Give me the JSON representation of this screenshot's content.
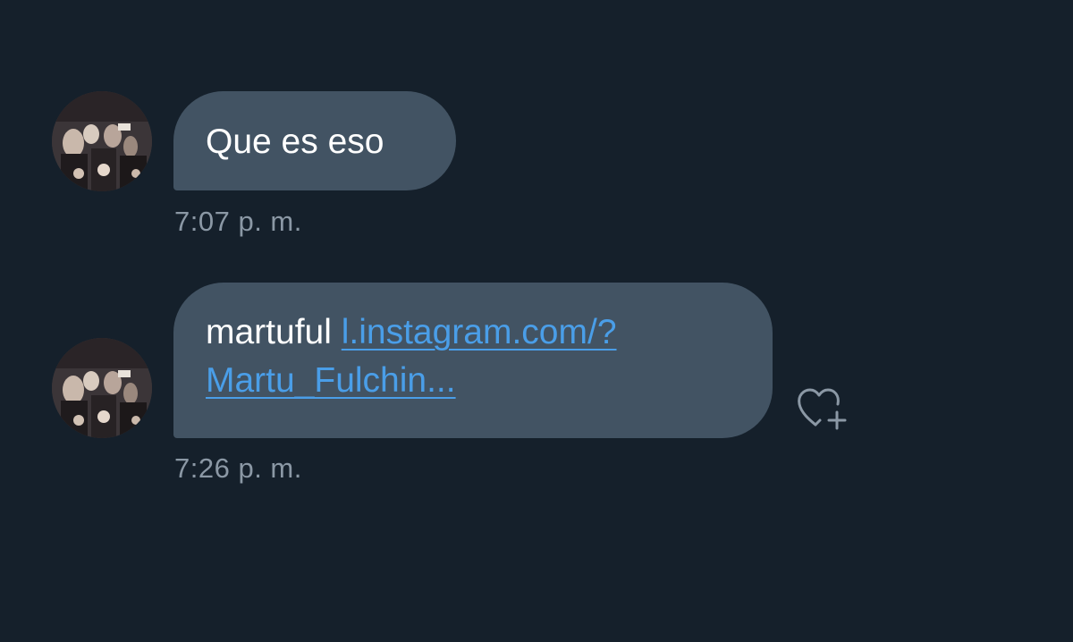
{
  "messages": [
    {
      "text": "Que es eso",
      "time": "7:07 p. m."
    },
    {
      "sender_text": "martuful",
      "link_text": "l.instagram.com/?Martu_Fulchin...",
      "time": "7:26 p. m."
    }
  ],
  "icons": {
    "avatar": "profile-photo",
    "react": "heart-plus-icon"
  },
  "colors": {
    "background": "#15202b",
    "bubble": "#425363",
    "link": "#4a9ee8",
    "timestamp": "#8b98a5"
  }
}
